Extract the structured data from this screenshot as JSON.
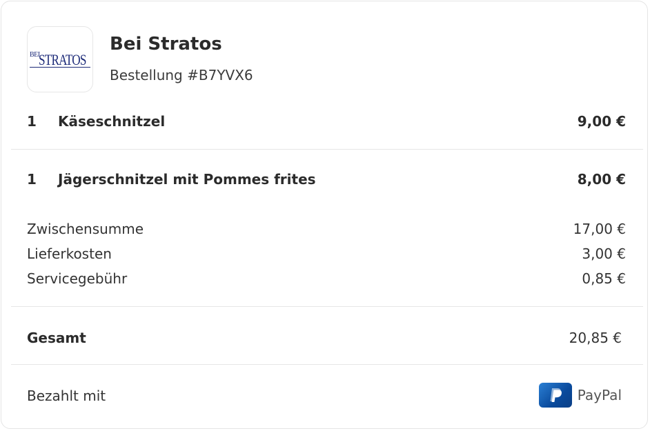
{
  "restaurant": {
    "logo_text": "STRATOS",
    "logo_prefix": "BEI",
    "name": "Bei Stratos",
    "order_number": "Bestellung #B7YVX6"
  },
  "items": [
    {
      "qty": "1",
      "name": "Käseschnitzel",
      "price": "9,00 €"
    },
    {
      "qty": "1",
      "name": "Jägerschnitzel mit Pommes frites",
      "price": "8,00 €"
    }
  ],
  "summary": [
    {
      "label": "Zwischensumme",
      "value": "17,00 €"
    },
    {
      "label": "Lieferkosten",
      "value": "3,00 €"
    },
    {
      "label": "Servicegebühr",
      "value": "0,85 €"
    }
  ],
  "total": {
    "label": "Gesamt",
    "value": "20,85 €"
  },
  "payment": {
    "label": "Bezahlt mit",
    "method": "PayPal",
    "icon": "paypal-icon",
    "icon_color": "#0a4a9c"
  }
}
